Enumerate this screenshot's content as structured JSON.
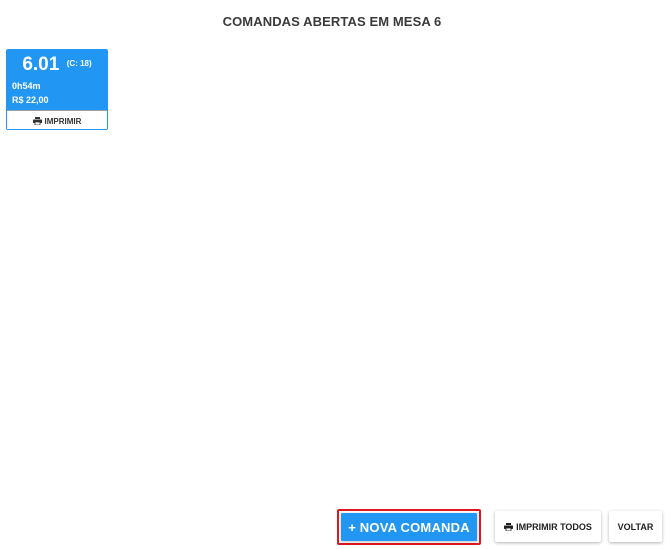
{
  "header": {
    "title": "COMANDAS ABERTAS EM MESA 6"
  },
  "comandas": [
    {
      "number": "6.01",
      "counter": "(C: 18)",
      "elapsed": "0h54m",
      "total": "R$ 22,00",
      "print_label": "IMPRIMIR",
      "print_icon": "printer-icon"
    }
  ],
  "footer": {
    "new_label": "+ NOVA COMANDA",
    "print_all_label": "IMPRIMIR TODOS",
    "print_all_icon": "printer-icon",
    "back_label": "VOLTAR"
  },
  "colors": {
    "accent": "#2196f3",
    "highlight_border": "#e0181e",
    "text_dark": "#3a3a3a"
  }
}
